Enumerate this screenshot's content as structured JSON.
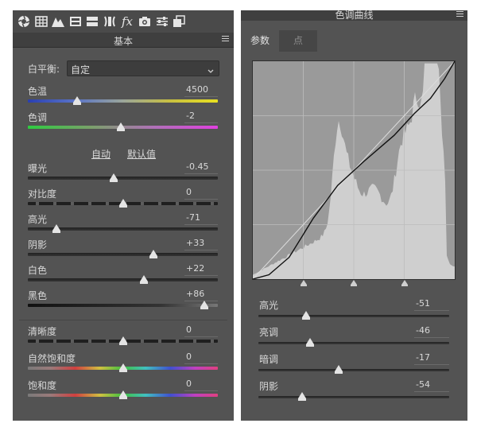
{
  "basic_panel": {
    "section_title": "基本",
    "toolbar_icons": [
      "aperture-icon",
      "grid-icon",
      "mountain-icon",
      "split-toning-icon",
      "lens-icon",
      "detail-icon",
      "fx-icon",
      "camera-icon",
      "sliders-icon",
      "presets-icon"
    ],
    "white_balance": {
      "label": "白平衡:",
      "value": "自定"
    },
    "auto_label": "自动",
    "default_label": "默认值",
    "sliders": [
      {
        "key": "temperature",
        "label": "色温",
        "value": "4500",
        "fraction": 0.26,
        "track": "temp"
      },
      {
        "key": "tint",
        "label": "色调",
        "value": "-2",
        "fraction": 0.49,
        "track": "tint"
      },
      {
        "key": "exposure",
        "label": "曝光",
        "value": "-0.45",
        "fraction": 0.45,
        "track": "plain"
      },
      {
        "key": "contrast",
        "label": "对比度",
        "value": "0",
        "fraction": 0.5,
        "track": "contrast"
      },
      {
        "key": "highlights",
        "label": "高光",
        "value": "-71",
        "fraction": 0.15,
        "track": "plain"
      },
      {
        "key": "shadows",
        "label": "阴影",
        "value": "+33",
        "fraction": 0.66,
        "track": "plain"
      },
      {
        "key": "whites",
        "label": "白色",
        "value": "+22",
        "fraction": 0.61,
        "track": "plain"
      },
      {
        "key": "blacks",
        "label": "黑色",
        "value": "+86",
        "fraction": 0.93,
        "track": "blacks"
      },
      {
        "key": "clarity",
        "label": "清晰度",
        "value": "0",
        "fraction": 0.5,
        "track": "contrast"
      },
      {
        "key": "vibrance",
        "label": "自然饱和度",
        "value": "0",
        "fraction": 0.5,
        "track": "rainbow"
      },
      {
        "key": "saturation",
        "label": "饱和度",
        "value": "0",
        "fraction": 0.5,
        "track": "rainbow"
      }
    ]
  },
  "tone_curve_panel": {
    "title": "色调曲线",
    "tabs": [
      {
        "label": "参数",
        "active": true
      },
      {
        "label": "点",
        "active": false
      }
    ],
    "region_splits": [
      0.25,
      0.5,
      0.75
    ],
    "sliders": [
      {
        "key": "highlights",
        "label": "高光",
        "value": "-51",
        "fraction": 0.25
      },
      {
        "key": "lights",
        "label": "亮调",
        "value": "-46",
        "fraction": 0.27
      },
      {
        "key": "darks",
        "label": "暗调",
        "value": "-17",
        "fraction": 0.42
      },
      {
        "key": "shadows",
        "label": "阴影",
        "value": "-54",
        "fraction": 0.23
      }
    ]
  }
}
